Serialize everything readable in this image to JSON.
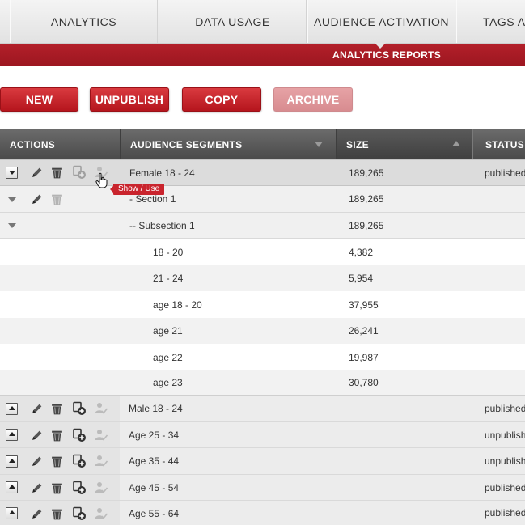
{
  "topnav": {
    "tabs": [
      {
        "label": "ANALYTICS"
      },
      {
        "label": "DATA USAGE"
      },
      {
        "label": "AUDIENCE ACTIVATION"
      },
      {
        "label": "TAGS AN"
      }
    ]
  },
  "subnav": {
    "active_label": "ANALYTICS REPORTS"
  },
  "toolbar": {
    "new_label": "NEW",
    "unpublish_label": "UNPUBLISH",
    "copy_label": "COPY",
    "archive_label": "ARCHIVE"
  },
  "table": {
    "headers": {
      "actions": "ACTIONS",
      "segments": "AUDIENCE SEGMENTS",
      "size": "SIZE",
      "status": "STATUS"
    },
    "tooltip": "Show / Use",
    "rows": [
      {
        "segment": "Female 18 - 24",
        "size": "189,265",
        "status": "published"
      },
      {
        "segment": "-  Section 1",
        "size": "189,265",
        "status": ""
      },
      {
        "segment": "--  Subsection 1",
        "size": "189,265",
        "status": ""
      },
      {
        "segment": "18 - 20",
        "size": "4,382",
        "status": ""
      },
      {
        "segment": "21 - 24",
        "size": "5,954",
        "status": ""
      },
      {
        "segment": "age 18 - 20",
        "size": "37,955",
        "status": ""
      },
      {
        "segment": "age 21",
        "size": "26,241",
        "status": ""
      },
      {
        "segment": "age 22",
        "size": "19,987",
        "status": ""
      },
      {
        "segment": "age 23",
        "size": "30,780",
        "status": ""
      },
      {
        "segment": "Male 18 - 24",
        "size": "",
        "status": "published"
      },
      {
        "segment": "Age 25 - 34",
        "size": "",
        "status": "unpublish"
      },
      {
        "segment": "Age 35 - 44",
        "size": "",
        "status": "unpublish"
      },
      {
        "segment": "Age 45 - 54",
        "size": "",
        "status": "published"
      },
      {
        "segment": "Age 55 - 64",
        "size": "",
        "status": "published"
      }
    ]
  },
  "colors": {
    "accent": "#b3202a",
    "header_bg": "#555555"
  }
}
